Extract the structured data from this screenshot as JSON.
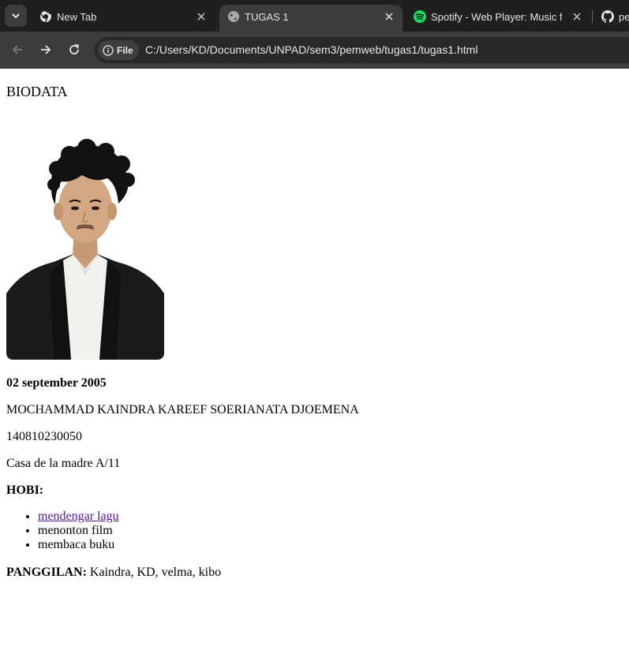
{
  "browser": {
    "tabs": [
      {
        "title": "New Tab",
        "icon": "chrome-icon",
        "active": false
      },
      {
        "title": "TUGAS 1",
        "icon": "globe-icon",
        "active": true
      },
      {
        "title": "Spotify - Web Player: Music for",
        "icon": "spotify-icon",
        "active": false
      },
      {
        "title": "pe",
        "icon": "github-icon",
        "active": false
      }
    ],
    "chip_label": "File",
    "url": "C:/Users/KD/Documents/UNPAD/sem3/pemweb/tugas1/tugas1.html"
  },
  "page": {
    "heading": "BIODATA",
    "birthdate": "02 september 2005",
    "name": "MOCHAMMAD KAINDRA KAREEF SOERIANATA DJOEMENA",
    "npm": "140810230050",
    "address": "Casa de la madre A/11",
    "hobby_label": "HOBI:",
    "hobbies": [
      "mendengar lagu",
      "menonton film",
      "membaca buku"
    ],
    "nickname_label": "PANGGILAN:",
    "nicknames": " Kaindra, KD, velma, kibo"
  },
  "colors": {
    "tabbar_bg": "#1f1f1f",
    "toolbar_bg": "#3c3c3c",
    "visited_link": "#551a8b",
    "spotify_green": "#1ed760"
  }
}
